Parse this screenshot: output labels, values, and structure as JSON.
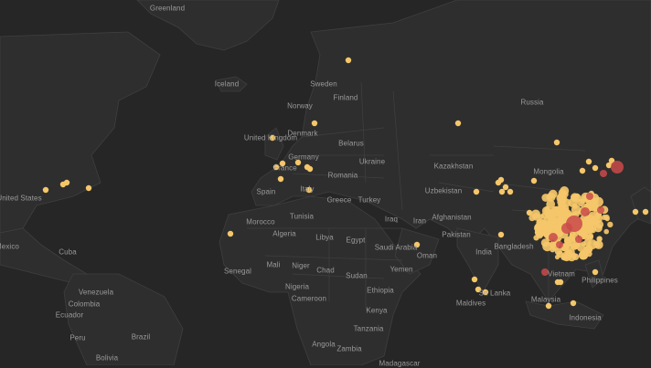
{
  "map": {
    "colors": {
      "water": "#262626",
      "land": "#2e2e2e",
      "border": "#404040",
      "label": "#9a9a9a",
      "point_light": "#f5c76a",
      "point_dark": "#c94a4a"
    },
    "labels": [
      {
        "key": "greenland",
        "text": "Greenland"
      },
      {
        "key": "iceland",
        "text": "Iceland"
      },
      {
        "key": "sweden",
        "text": "Sweden"
      },
      {
        "key": "finland",
        "text": "Finland"
      },
      {
        "key": "norway",
        "text": "Norway"
      },
      {
        "key": "russia",
        "text": "Russia"
      },
      {
        "key": "denmark",
        "text": "Denmark"
      },
      {
        "key": "united-kingdom",
        "text": "United Kingdom"
      },
      {
        "key": "belarus",
        "text": "Belarus"
      },
      {
        "key": "germany",
        "text": "Germany"
      },
      {
        "key": "ukraine",
        "text": "Ukraine"
      },
      {
        "key": "france",
        "text": "France"
      },
      {
        "key": "romania",
        "text": "Romania"
      },
      {
        "key": "kazakhstan",
        "text": "Kazakhstan"
      },
      {
        "key": "mongolia",
        "text": "Mongolia"
      },
      {
        "key": "spain",
        "text": "Spain"
      },
      {
        "key": "italy",
        "text": "Italy"
      },
      {
        "key": "greece",
        "text": "Greece"
      },
      {
        "key": "turkey",
        "text": "Turkey"
      },
      {
        "key": "uzbekistan",
        "text": "Uzbekistan"
      },
      {
        "key": "united-states",
        "text": "United States"
      },
      {
        "key": "tunisia",
        "text": "Tunisia"
      },
      {
        "key": "afghanistan",
        "text": "Afghanistan"
      },
      {
        "key": "iraq",
        "text": "Iraq"
      },
      {
        "key": "iran",
        "text": "Iran"
      },
      {
        "key": "morocco",
        "text": "Morocco"
      },
      {
        "key": "libya",
        "text": "Libya"
      },
      {
        "key": "egypt",
        "text": "Egypt"
      },
      {
        "key": "pakistan",
        "text": "Pakistan"
      },
      {
        "key": "algeria",
        "text": "Algeria"
      },
      {
        "key": "saudi-arabia",
        "text": "Saudi Arabia"
      },
      {
        "key": "bangladesh",
        "text": "Bangladesh"
      },
      {
        "key": "mexico",
        "text": "Mexico"
      },
      {
        "key": "cuba",
        "text": "Cuba"
      },
      {
        "key": "india",
        "text": "India"
      },
      {
        "key": "oman",
        "text": "Oman"
      },
      {
        "key": "mali",
        "text": "Mali"
      },
      {
        "key": "niger",
        "text": "Niger"
      },
      {
        "key": "chad",
        "text": "Chad"
      },
      {
        "key": "sudan",
        "text": "Sudan"
      },
      {
        "key": "yemen",
        "text": "Yemen"
      },
      {
        "key": "senegal",
        "text": "Senegal"
      },
      {
        "key": "vietnam",
        "text": "Vietnam"
      },
      {
        "key": "philippines",
        "text": "Philippines"
      },
      {
        "key": "nigeria",
        "text": "Nigeria"
      },
      {
        "key": "ethiopia",
        "text": "Ethiopia"
      },
      {
        "key": "venezuela",
        "text": "Venezuela"
      },
      {
        "key": "cameroon",
        "text": "Cameroon"
      },
      {
        "key": "maldives",
        "text": "Maldives"
      },
      {
        "key": "sri-lanka",
        "text": "Sri Lanka"
      },
      {
        "key": "malaysia",
        "text": "Malaysia"
      },
      {
        "key": "colombia",
        "text": "Colombia"
      },
      {
        "key": "kenya",
        "text": "Kenya"
      },
      {
        "key": "ecuador",
        "text": "Ecuador"
      },
      {
        "key": "indonesia",
        "text": "Indonesia"
      },
      {
        "key": "tanzania",
        "text": "Tanzania"
      },
      {
        "key": "brazil",
        "text": "Brazil"
      },
      {
        "key": "peru",
        "text": "Peru"
      },
      {
        "key": "angola",
        "text": "Angola"
      },
      {
        "key": "zambia",
        "text": "Zambia"
      },
      {
        "key": "bolivia",
        "text": "Bolivia"
      },
      {
        "key": "madagascar",
        "text": "Madagascar"
      }
    ]
  }
}
